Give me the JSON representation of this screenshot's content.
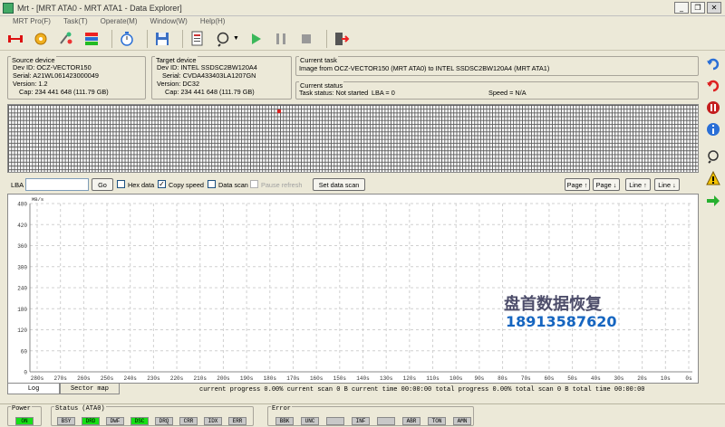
{
  "window": {
    "title": "Mrt - [MRT ATA0 - MRT ATA1 - Data Explorer]"
  },
  "menu": [
    "MRT Pro(F)",
    "Task(T)",
    "Operate(M)",
    "Window(W)",
    "Help(H)"
  ],
  "window_buttons": {
    "minimize": "_",
    "restore": "❐",
    "close": "✕"
  },
  "source": {
    "group_title": "Source device",
    "dev_id": "Dev ID: OCZ-VECTOR150",
    "serial": "Serial: A21WL061423000049",
    "version": "Version: 1.2",
    "cap": "Cap: 234 441 648 (111.79 GB)"
  },
  "target": {
    "group_title": "Target device",
    "dev_id": "Dev ID: INTEL SSDSC2BW120A4",
    "serial": "Serial: CVDA433403LA1207GN",
    "version": "Version: DC32",
    "cap": "Cap: 234 441 648 (111.79 GB)"
  },
  "task": {
    "group_title": "Current task",
    "text": "Image from OCZ-VECTOR150 (MRT ATA0) to INTEL SSDSC2BW120A4 (MRT ATA1)"
  },
  "status": {
    "group_title": "Current status",
    "task_status": "Task status: Not started",
    "lba": "LBA = 0",
    "speed": "Speed = N/A"
  },
  "controls": {
    "lba_label": "LBA",
    "lba_value": "",
    "go": "Go",
    "hex_data": "Hex data",
    "copy_speed": "Copy speed",
    "data_scan": "Data scan",
    "pause_refresh": "Pause refresh",
    "set_data_scan": "Set data scan",
    "page_up": "Page ↑",
    "page_down": "Page ↓",
    "line_up": "Line ↑",
    "line_down": "Line ↓"
  },
  "checkbox_state": {
    "hex_data": false,
    "copy_speed": true,
    "data_scan": false,
    "pause_refresh": false
  },
  "chart_data": {
    "type": "line",
    "ylabel": "MB/s",
    "ylim": [
      0,
      480
    ],
    "yticks": [
      "480",
      "420",
      "360",
      "300",
      "240",
      "180",
      "120",
      "60",
      "0"
    ],
    "xticks": [
      "280s",
      "270s",
      "260s",
      "250s",
      "240s",
      "230s",
      "220s",
      "210s",
      "200s",
      "190s",
      "180s",
      "170s",
      "160s",
      "150s",
      "140s",
      "130s",
      "120s",
      "110s",
      "100s",
      "90s",
      "80s",
      "70s",
      "60s",
      "50s",
      "40s",
      "30s",
      "20s",
      "10s",
      "0s"
    ],
    "series": [],
    "grid": true
  },
  "tabs": [
    "Log",
    "Sector map"
  ],
  "progress_text": "current progress 0.00% current scan  0 B  current time  00:00:00  total progress 0.00% total scan 0 B total time 00:00:00",
  "status_groups": {
    "power": {
      "title": "Power",
      "indicators": [
        {
          "label": "ON",
          "on": true
        }
      ]
    },
    "status": {
      "title": "Status (ATA0)",
      "indicators": [
        {
          "label": "BSY",
          "on": false
        },
        {
          "label": "DRD",
          "on": true
        },
        {
          "label": "DWF",
          "on": false
        },
        {
          "label": "DSC",
          "on": true
        },
        {
          "label": "DRQ",
          "on": false
        },
        {
          "label": "CRR",
          "on": false
        },
        {
          "label": "IDX",
          "on": false
        },
        {
          "label": "ERR",
          "on": false
        }
      ]
    },
    "error": {
      "title": "Error",
      "indicators": [
        {
          "label": "BBK",
          "on": false
        },
        {
          "label": "UNC",
          "on": false
        },
        {
          "label": "",
          "on": false
        },
        {
          "label": "INF",
          "on": false
        },
        {
          "label": "",
          "on": false
        },
        {
          "label": "ABR",
          "on": false
        },
        {
          "label": "TON",
          "on": false
        },
        {
          "label": "AMN",
          "on": false
        }
      ]
    }
  },
  "watermark": {
    "line1": "盘首数据恢复",
    "line2": "18913587620"
  }
}
